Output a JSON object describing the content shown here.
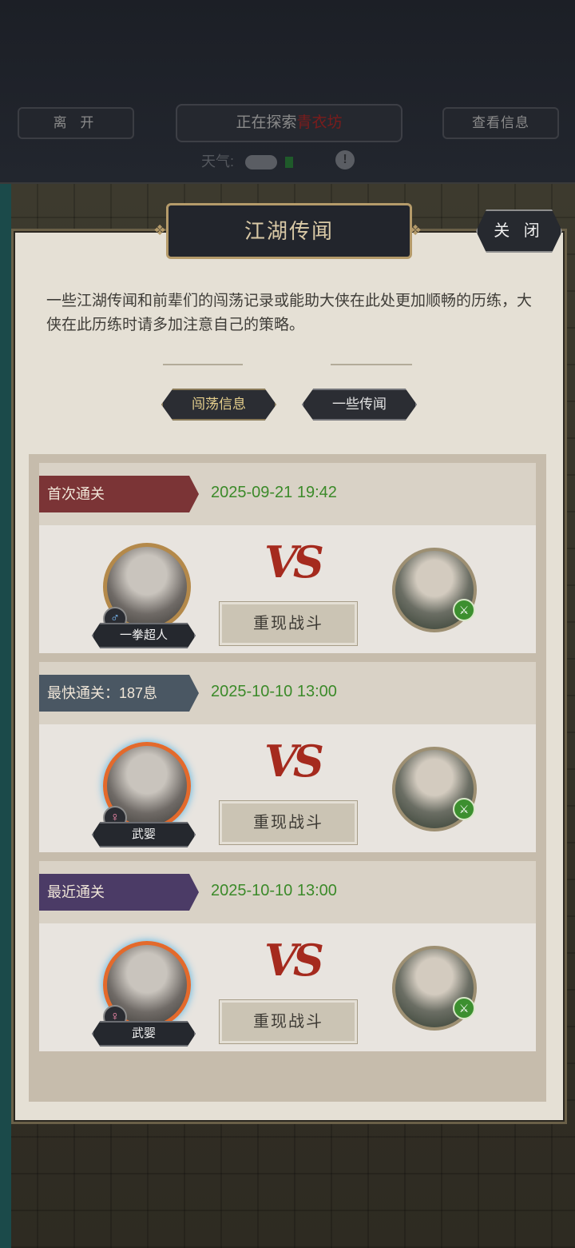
{
  "topbar": {
    "leave_label": "离 开",
    "explore_prefix": "正在探索",
    "explore_location": "青衣坊",
    "info_label": "查看信息",
    "weather_label": "天气:",
    "weather_icon": "cloud-icon",
    "warning_icon": "!"
  },
  "panel": {
    "title": "江湖传闻",
    "close_label": "关 闭",
    "description": "一些江湖传闻和前辈们的闯荡记录或能助大侠在此处更加顺畅的历练，大侠在此历练时请多加注意自己的策略。",
    "tabs": [
      {
        "label": "闯荡信息",
        "active": true
      },
      {
        "label": "一些传闻",
        "active": false
      }
    ]
  },
  "records": [
    {
      "badge": "首次通关",
      "badge_color": "#7b3436",
      "date": "2025-09-21 19:42",
      "player_name": "一拳超人",
      "player_gender": "♂",
      "vs": "VS",
      "replay_label": "重现战斗"
    },
    {
      "badge": "最快通关：187息",
      "badge_color": "#4a5763",
      "date": "2025-10-10 13:00",
      "player_name": "武婴",
      "player_gender": "♀",
      "vs": "VS",
      "replay_label": "重现战斗"
    },
    {
      "badge": "最近通关",
      "badge_color": "#4b3b66",
      "date": "2025-10-10 13:00",
      "player_name": "武婴",
      "player_gender": "♀",
      "vs": "VS",
      "replay_label": "重现战斗"
    }
  ],
  "colors": {
    "date_green": "#3b8a29",
    "vs_red": "#a52a1e",
    "panel_bg": "#e5e0d5"
  }
}
